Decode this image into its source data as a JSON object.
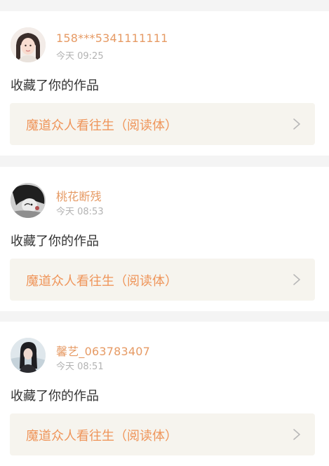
{
  "notifications": [
    {
      "username": "158***5341111111",
      "time": "今天 09:25",
      "action": "收藏了你的作品",
      "work_title": "魔道众人看往生（阅读体）"
    },
    {
      "username": "桃花断残",
      "time": "今天 08:53",
      "action": "收藏了你的作品",
      "work_title": "魔道众人看往生（阅读体）"
    },
    {
      "username": "馨艺_063783407",
      "time": "今天 08:51",
      "action": "收藏了你的作品",
      "work_title": "魔道众人看往生（阅读体）"
    }
  ],
  "colors": {
    "username": "#e69a64",
    "work_title": "#ef955a",
    "work_card_bg": "#f6f4ee",
    "page_bg": "#f4f4f4"
  },
  "icons": {
    "chevron": "chevron-right-icon"
  }
}
